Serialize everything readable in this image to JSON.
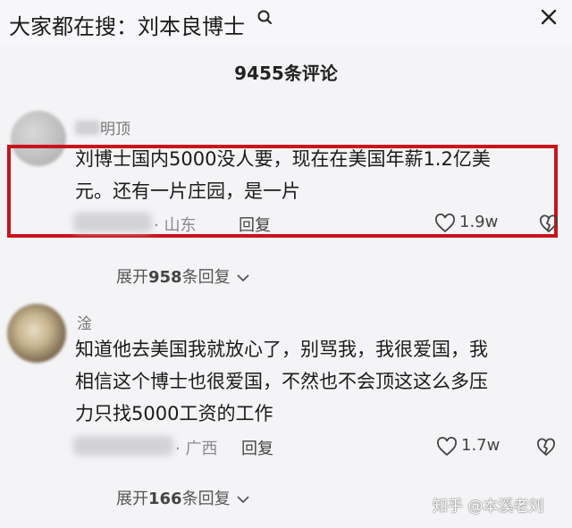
{
  "search": {
    "prefix": "大家都在搜：",
    "query": "刘本良博士"
  },
  "header": {
    "comment_count": "9455条评论"
  },
  "comments": [
    {
      "username": "明顶",
      "text_line1": "刘博士国内5000没人要，现在在美国年薪1.2亿美",
      "text_line2": "元。还有一片庄园，是一片",
      "location": "· 山东",
      "reply_label": "回复",
      "likes": "1.9w",
      "expand_prefix": "展开",
      "expand_count": "958",
      "expand_suffix": "条回复"
    },
    {
      "username": "淦",
      "text_line1": "知道他去美国我就放心了，别骂我，我很爱国，我",
      "text_line2": "相信这个博士也很爱国，不然也不会顶这这么多压",
      "text_line3": "力只找5000工资的工作",
      "location": "· 广西",
      "reply_label": "回复",
      "likes": "1.7w",
      "expand_prefix": "展开",
      "expand_count": "166",
      "expand_suffix": "条回复"
    }
  ],
  "watermark": "知乎 @本溪老刘",
  "colors": {
    "highlight": "#c8141c",
    "background": "#f4f4f6"
  },
  "icons": [
    "search-icon",
    "close-icon",
    "heart-icon",
    "dislike-icon",
    "chevron-down-icon"
  ]
}
